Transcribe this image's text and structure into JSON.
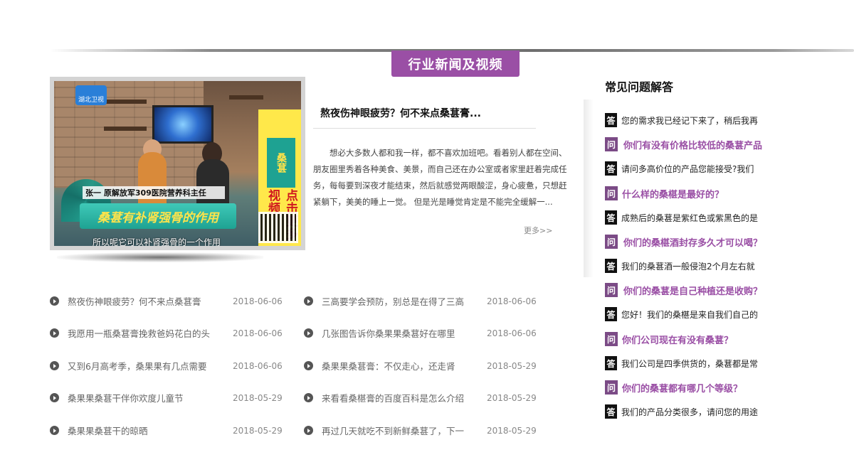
{
  "section_title": "行业新闻及视频",
  "video": {
    "channel_logo": "湖北卫视",
    "name_caption": "张一  原解放军309医院营养科主任",
    "main_caption": "桑葚有补肾强骨的作用",
    "subtitle": "所以呢它可以补肾强骨的一个作用",
    "promo_tag": "桑葚",
    "promo_text": "点击更多视频"
  },
  "featured": {
    "title": "熬夜伤神眼疲劳？何不来点桑葚膏...",
    "body": "想必大多数人都和我一样，都不喜欢加班吧。看着别人都在空间、朋友圈里秀着各种美食、美景，而自己还在办公室或者家里赶着完成任务，每每要到深夜才能结束，然后就感觉两眼酸涩，身心疲惫，只想赶紧躺下，美美的睡上一觉。 但是光是睡觉肯定是不能完全缓解一...",
    "more_label": "更多>>"
  },
  "news_left": [
    {
      "title": "熬夜伤神眼疲劳？何不来点桑葚膏",
      "date": "2018-06-06"
    },
    {
      "title": "我愿用一瓶桑葚膏挽救爸妈花白的头",
      "date": "2018-06-06"
    },
    {
      "title": "又到6月高考季，桑果果有几点需要",
      "date": "2018-06-06"
    },
    {
      "title": "桑果果桑葚干伴你欢度儿童节",
      "date": "2018-05-29"
    },
    {
      "title": "桑果果桑葚干的晾晒",
      "date": "2018-05-29"
    }
  ],
  "news_right": [
    {
      "title": "三高要学会预防，别总是在得了三高",
      "date": "2018-06-06"
    },
    {
      "title": "几张图告诉你桑果果桑葚好在哪里",
      "date": "2018-06-06"
    },
    {
      "title": "桑果果桑葚膏：不仅走心，还走肾",
      "date": "2018-05-29"
    },
    {
      "title": "来看看桑椹膏的百度百科是怎么介绍",
      "date": "2018-05-29"
    },
    {
      "title": "再过几天就吃不到新鲜桑葚了，下一",
      "date": "2018-05-29"
    }
  ],
  "faq": {
    "heading": "常见问题解答",
    "answer_badge": "答",
    "question_badge": "问",
    "first_answer": "您的需求我已经记下来了，稍后我再",
    "items": [
      {
        "question": "你们有没有价格比较低的桑葚产品",
        "answer": "请问多高价位的产品您能接受?我们"
      },
      {
        "question": "什么样的桑椹是最好的？",
        "answer": "成熟后的桑葚是紫红色或紫黑色的是"
      },
      {
        "question": "你们的桑椹酒封存多久才可以喝？",
        "answer": "我们的桑葚酒一般侵泡2个月左右就"
      },
      {
        "question": "你们的桑葚是自己种植还是收购？",
        "answer": "您好！我们的桑椹是来自我们自己的"
      },
      {
        "question": "你们公司现在有没有桑葚？",
        "answer": "我们公司是四季供货的，桑葚都是常"
      },
      {
        "question": "你们的桑葚都有哪几个等级？",
        "answer": "我们的产品分类很多，请问您的用途"
      }
    ]
  }
}
